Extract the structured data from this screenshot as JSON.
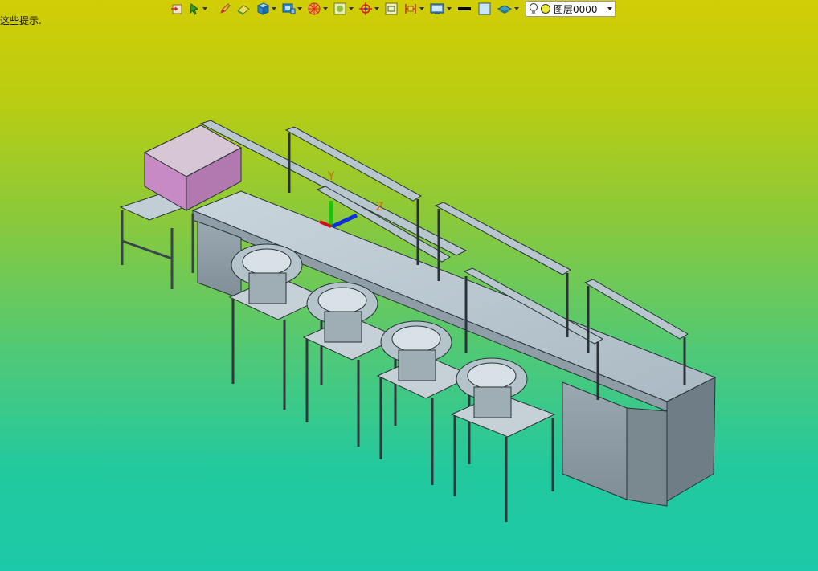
{
  "status": {
    "hint_text": "这些提示."
  },
  "toolbar": {
    "buttons": [
      {
        "icon": "import-icon",
        "dropdown": false
      },
      {
        "icon": "select-icon",
        "dropdown": true
      },
      {
        "icon": "pencil-icon",
        "dropdown": false
      },
      {
        "icon": "eraser-icon",
        "dropdown": false
      },
      {
        "icon": "cube-view-icon",
        "dropdown": true
      },
      {
        "icon": "display-mode-icon",
        "dropdown": true
      },
      {
        "icon": "color-wheel-icon",
        "dropdown": true
      },
      {
        "icon": "render-icon",
        "dropdown": true
      },
      {
        "icon": "crosshair-icon",
        "dropdown": true
      },
      {
        "icon": "fit-view-icon",
        "dropdown": false
      },
      {
        "icon": "section-icon",
        "dropdown": true
      },
      {
        "icon": "display-settings-icon",
        "dropdown": true
      },
      {
        "icon": "line-color-icon",
        "dropdown": false
      },
      {
        "icon": "fill-color-icon",
        "dropdown": false
      },
      {
        "icon": "layers-icon",
        "dropdown": true
      }
    ],
    "layer": {
      "name": "图层0000"
    }
  },
  "viewport": {
    "background_top": "#d2cd05",
    "background_bottom": "#1cc9a8",
    "axes": {
      "y_label": "Y",
      "z_label": "Z"
    }
  }
}
